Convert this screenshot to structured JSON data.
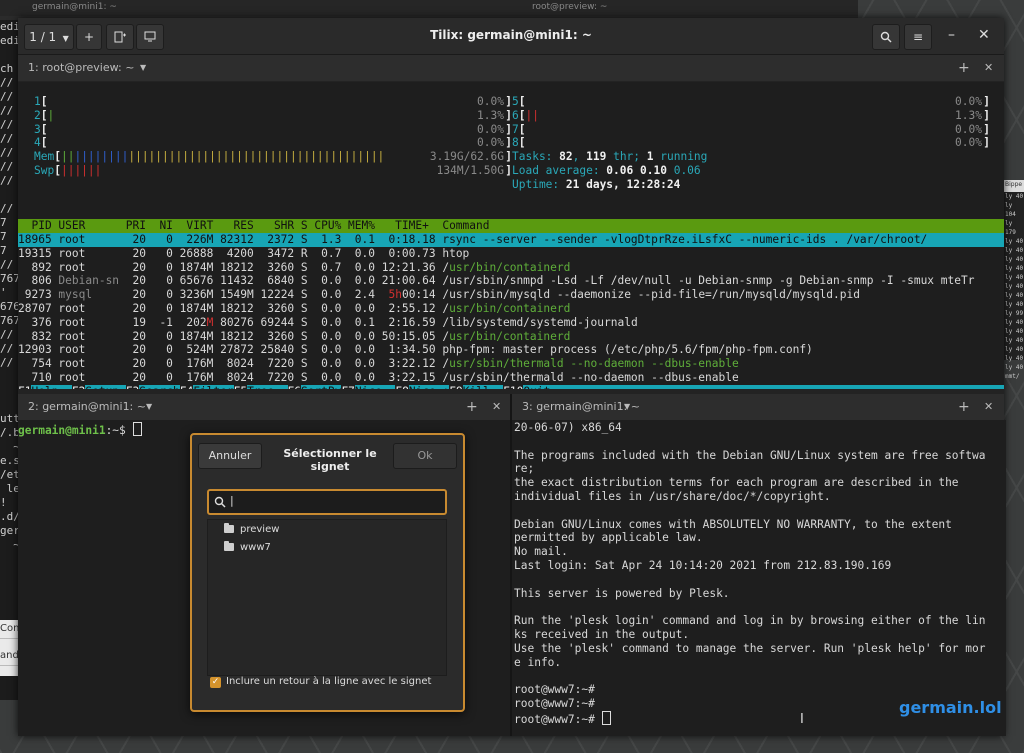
{
  "background": {
    "tabs": [
      "germain@mini1: ~",
      "root@preview: ~"
    ],
    "left_text": [
      "edi",
      "edi",
      "",
      "ch",
      "//",
      "//",
      "//",
      "//",
      "//",
      "//",
      "//",
      "//",
      "",
      "//",
      "7",
      "7",
      "7",
      "//",
      "767",
      "'",
      "676",
      "767",
      "//",
      "//",
      "//",
      "",
      "",
      "",
      "utt",
      "/.b",
      "  ~",
      "e.s",
      "/et",
      " le",
      "!",
      ".d/",
      "ger",
      "  ~/"
    ],
    "cmd_labels": [
      "Com",
      "and"
    ],
    "right_lines": [
      "ly 40",
      "ly 104",
      "ly 179",
      "ly 40",
      "ly 40",
      "ly 40",
      "ly 40",
      "ly 40",
      "ly 40",
      "ly 40",
      "ly 40",
      "ly 99",
      "ly 40",
      "ly 40",
      "ly 40",
      "ly 40",
      "ly 40",
      "ly 40",
      "mmt/"
    ],
    "right_header": "Bippe"
  },
  "window": {
    "title": "Tilix: germain@mini1: ~",
    "session_label": "1 / 1",
    "pane1_title": "1: root@preview: ~",
    "pane2_title": "2: germain@mini1: ~",
    "pane3_title": "3: germain@mini1: ~"
  },
  "htop": {
    "cpu_left": [
      [
        "1",
        "0.0%"
      ],
      [
        "2",
        "1.3%"
      ],
      [
        "3",
        "0.0%"
      ],
      [
        "4",
        "0.0%"
      ]
    ],
    "cpu_right": [
      [
        "5",
        "0.0%"
      ],
      [
        "6",
        "1.3%"
      ],
      [
        "7",
        "0.0%"
      ],
      [
        "8",
        "0.0%"
      ]
    ],
    "mem": "3.19G/62.6G",
    "swp": "134M/1.50G",
    "tasks": "82",
    "thr": "119",
    "running": "1",
    "load1": "0.06",
    "load5": "0.10",
    "load15": "0.06",
    "uptime": "21 days, 12:28:24",
    "header": "  PID USER      PRI  NI  VIRT   RES   SHR S CPU% MEM%   TIME+  Command",
    "processes": [
      "18965 root       20   0  226M 82312  2372 S  1.3  0.1  0:18.18 rsync --server --sender -vlogDtprRze.iLsfxC --numeric-ids . /var/chroot/",
      "19315 root       20   0 26888  4200  3472 R  0.7  0.0  0:00.73 htop",
      "  892 root       20   0 1874M 18212  3260 S  0.7  0.0 12:21.36 /usr/bin/containerd",
      "  806 Debian-sn  20   0 65676 11432  6840 S  0.0  0.0 21:00.64 /usr/sbin/snmpd -Lsd -Lf /dev/null -u Debian-snmp -g Debian-snmp -I -smux mteTr",
      " 9273 mysql      20   0 3236M 1549M 12224 S  0.0  2.4  5h00:14 /usr/sbin/mysqld --daemonize --pid-file=/run/mysqld/mysqld.pid",
      "28707 root       20   0 1874M 18212  3260 S  0.0  0.0  2:55.12 /usr/bin/containerd",
      "  376 root       19  -1  202M 80276 69244 S  0.0  0.1  2:16.59 /lib/systemd/systemd-journald",
      "  832 root       20   0 1874M 18212  3260 S  0.0  0.0 50:15.05 /usr/bin/containerd",
      "12903 root       20   0  524M 27872 25840 S  0.0  0.0  1:34.50 php-fpm: master process (/etc/php/5.6/fpm/php-fpm.conf)",
      "  754 root       20   0  176M  8024  7220 S  0.0  0.0  3:22.12 /usr/sbin/thermald --no-daemon --dbus-enable",
      "  710 root       20   0  176M  8024  7220 S  0.0  0.0  3:22.15 /usr/sbin/thermald --no-daemon --dbus-enable"
    ],
    "fkeys": [
      [
        "F1",
        "Help  "
      ],
      [
        "F2",
        "Setup "
      ],
      [
        "F3",
        "Search"
      ],
      [
        "F4",
        "Filter"
      ],
      [
        "F5",
        "Tree  "
      ],
      [
        "F6",
        "SortBy"
      ],
      [
        "F7",
        "Nice -"
      ],
      [
        "F8",
        "Nice +"
      ],
      [
        "F9",
        "Kill  "
      ],
      [
        "F10",
        "Quit  "
      ]
    ]
  },
  "pane2": {
    "prompt_user": "germain@mini1",
    "prompt_rest": ":~$ "
  },
  "pane3": {
    "lines": [
      "20-06-07) x86_64",
      "",
      "The programs included with the Debian GNU/Linux system are free softwa",
      "re;",
      "the exact distribution terms for each program are described in the",
      "individual files in /usr/share/doc/*/copyright.",
      "",
      "Debian GNU/Linux comes with ABSOLUTELY NO WARRANTY, to the extent",
      "permitted by applicable law.",
      "No mail.",
      "Last login: Sat Apr 24 10:14:20 2021 from 212.83.190.169",
      "",
      "This server is powered by Plesk.",
      "",
      "Run the 'plesk login' command and log in by browsing either of the lin",
      "ks received in the output.",
      "Use the 'plesk' command to manage the server. Run 'plesk help' for mor",
      "e info.",
      "",
      "root@www7:~#",
      "root@www7:~#",
      "root@www7:~# "
    ]
  },
  "dialog": {
    "cancel": "Annuler",
    "title": "Sélectionner le signet",
    "ok": "Ok",
    "search_value": "|",
    "bookmarks": [
      "preview",
      "www7"
    ],
    "checkbox_label": "Inclure un retour à la ligne avec le signet",
    "checkbox_checked": true
  },
  "watermark": "germain.lol",
  "colors": {
    "accent": "#c88a30",
    "htop_header": "#5a9a10",
    "htop_select": "#17a5b5",
    "watermark": "#2f8fe6"
  }
}
